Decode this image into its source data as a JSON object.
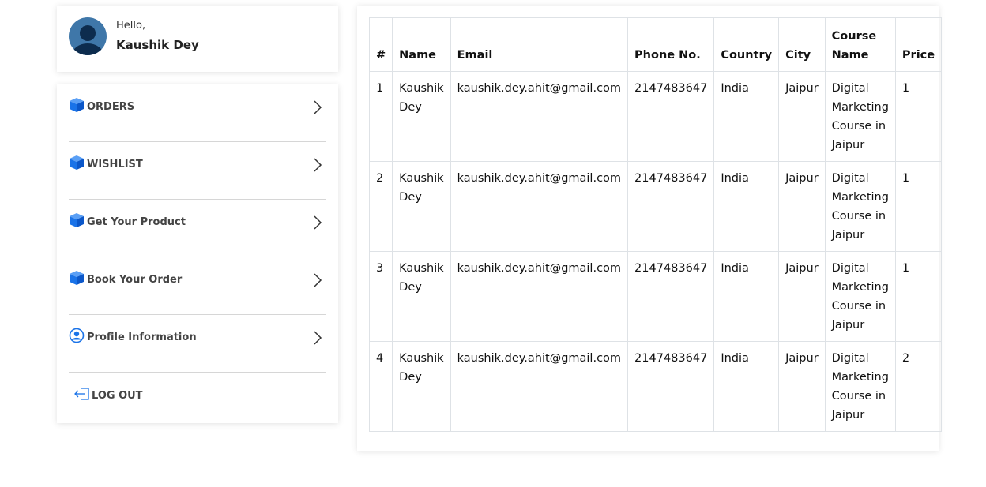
{
  "profile": {
    "greeting": "Hello,",
    "name": "Kaushik Dey"
  },
  "menu": {
    "items": [
      {
        "label": "ORDERS",
        "icon": "cube-icon"
      },
      {
        "label": "WISHLIST",
        "icon": "cube-icon"
      },
      {
        "label": "Get Your Product",
        "icon": "cube-icon"
      },
      {
        "label": "Book Your Order",
        "icon": "cube-icon"
      },
      {
        "label": "Profile Information",
        "icon": "user-circle-icon"
      }
    ],
    "logout_label": "LOG OUT",
    "accent_color": "#1a73e8"
  },
  "table": {
    "headers": [
      "#",
      "Name",
      "Email",
      "Phone No.",
      "Country",
      "City",
      "Course Name",
      "Price"
    ],
    "rows": [
      [
        "1",
        "Kaushik Dey",
        "kaushik.dey.ahit@gmail.com",
        "2147483647",
        "India",
        "Jaipur",
        "Digital Marketing Course in Jaipur",
        "1"
      ],
      [
        "2",
        "Kaushik Dey",
        "kaushik.dey.ahit@gmail.com",
        "2147483647",
        "India",
        "Jaipur",
        "Digital Marketing Course in Jaipur",
        "1"
      ],
      [
        "3",
        "Kaushik Dey",
        "kaushik.dey.ahit@gmail.com",
        "2147483647",
        "India",
        "Jaipur",
        "Digital Marketing Course in Jaipur",
        "1"
      ],
      [
        "4",
        "Kaushik Dey",
        "kaushik.dey.ahit@gmail.com",
        "2147483647",
        "India",
        "Jaipur",
        "Digital Marketing Course in Jaipur",
        "2"
      ]
    ]
  }
}
